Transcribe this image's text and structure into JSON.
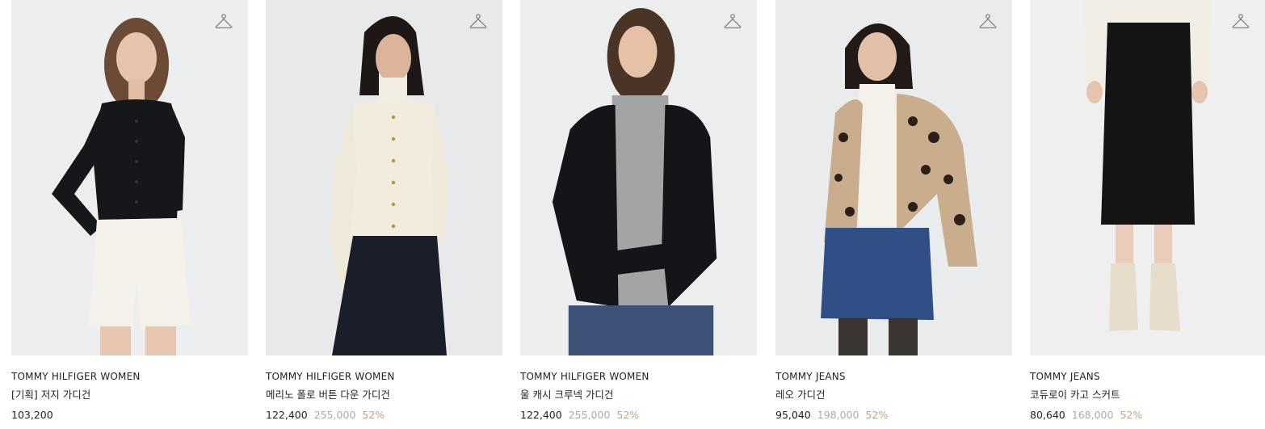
{
  "products": [
    {
      "brand": "TOMMY HILFIGER WOMEN",
      "name": "[기획] 저지 가디건",
      "price": "103,200",
      "original_price": "",
      "discount": ""
    },
    {
      "brand": "TOMMY HILFIGER WOMEN",
      "name": "메리노 폴로 버튼 다운 가디건",
      "price": "122,400",
      "original_price": "255,000",
      "discount": "52%"
    },
    {
      "brand": "TOMMY HILFIGER WOMEN",
      "name": "울 캐시 크루넥 가디건",
      "price": "122,400",
      "original_price": "255,000",
      "discount": "52%"
    },
    {
      "brand": "TOMMY JEANS",
      "name": "레오 가디건",
      "price": "95,040",
      "original_price": "198,000",
      "discount": "52%"
    },
    {
      "brand": "TOMMY JEANS",
      "name": "코듀로이 카고 스커트",
      "price": "80,640",
      "original_price": "168,000",
      "discount": "52%"
    }
  ],
  "icons": {
    "wishlist": "hanger-icon"
  },
  "colors": {
    "image_bg": "#eeeff0",
    "discount": "#c9a27e",
    "original_price": "#aaaaaa"
  }
}
